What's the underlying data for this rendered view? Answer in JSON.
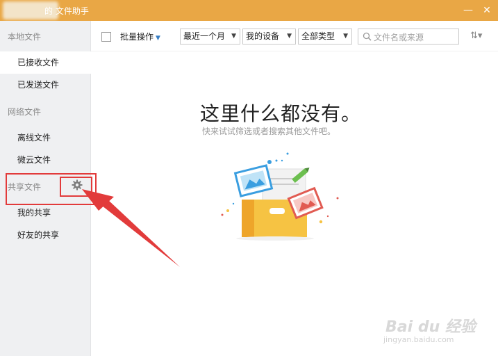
{
  "window": {
    "title": "的 文件助手",
    "minimize_label": "—",
    "close_label": "✕"
  },
  "sidebar": {
    "local_section": "本地文件",
    "received": "已接收文件",
    "sent": "已发送文件",
    "network_section": "网络文件",
    "offline": "离线文件",
    "weiyun": "微云文件",
    "share_section": "共享文件",
    "my_share": "我的共享",
    "friend_share": "好友的共享"
  },
  "toolbar": {
    "batch_label": "批量操作",
    "time_filter": "最近一个月",
    "device_filter": "我的设备",
    "type_filter": "全部类型",
    "search_placeholder": "文件名或来源"
  },
  "main": {
    "empty_title": "这里什么都没有。",
    "empty_subtitle": "快来试试筛选或者搜索其他文件吧。"
  },
  "watermark": {
    "brand": "Bai du 经验",
    "url": "jingyan.baidu.com"
  },
  "colors": {
    "titlebar": "#e9a745",
    "highlight": "#e23b3b",
    "sidebar_bg": "#eff0f2"
  }
}
